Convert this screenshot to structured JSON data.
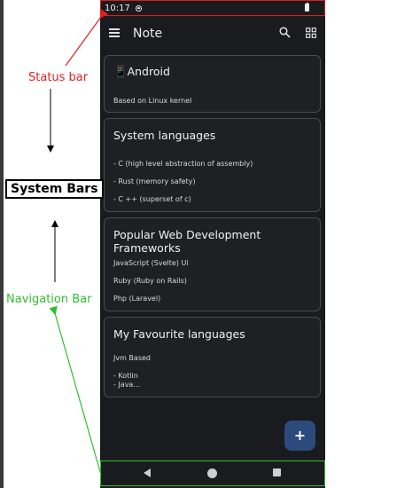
{
  "status_bar": {
    "time": "10:17",
    "icons": [
      "circle-status-icon",
      "battery-icon"
    ]
  },
  "app_bar": {
    "title": "Note",
    "icons": [
      "menu-icon",
      "search-icon",
      "grid-view-icon"
    ]
  },
  "notes": [
    {
      "title": "📱Android",
      "lines": [
        "Based on Linux kernel"
      ]
    },
    {
      "title": "System languages",
      "lines": [
        "- C (high level abstraction of assembly)",
        "- Rust (memory safety)",
        "- C ++ (superset of c)"
      ]
    },
    {
      "title": "Popular Web Development Frameworks",
      "lines": [
        "JavaScript (Svelte) Ui",
        "Ruby (Ruby on Rails)",
        "Php (Laravel)"
      ]
    },
    {
      "title": "My Favourite languages",
      "lines": [
        "Jvm Based",
        "- Kotlin",
        "- Java…"
      ]
    }
  ],
  "fab": {
    "label": "+"
  },
  "nav_bar": {
    "icons": [
      "back-icon",
      "home-icon",
      "recents-icon"
    ]
  },
  "annotations": {
    "status_bar": "Status bar",
    "system_bars": "System Bars",
    "navigation_bar": "Navigation Bar"
  },
  "colors": {
    "status_annotation": "#e02020",
    "navigation_annotation": "#2fbf2f",
    "background": "#1a1b1e",
    "fab": "#2c4a7c"
  }
}
